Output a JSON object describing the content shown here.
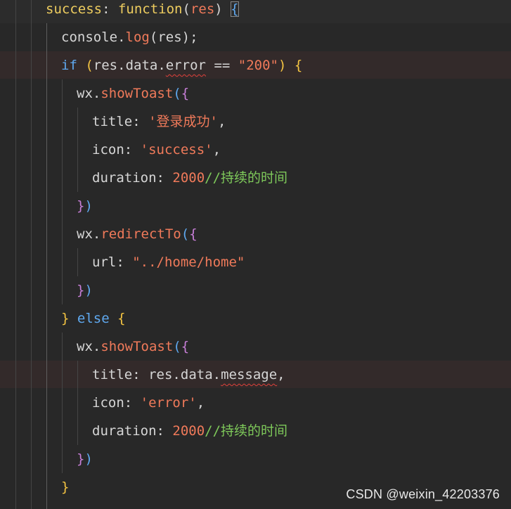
{
  "editor": {
    "theme": {
      "background": "#282828",
      "default_text": "#d6d6d6",
      "key": "#e8c4a0",
      "keyword": "#5fa9f0",
      "function": "#f07a5a",
      "string": "#f07a5a",
      "number": "#f07a5a",
      "comment": "#7ec95a",
      "paren_1": "#f5c542",
      "paren_2": "#5fa9f0",
      "paren_3": "#c87fd8",
      "squiggle": "#e0413b"
    },
    "lines": [
      {
        "indent": 65,
        "tokens": [
          {
            "t": "success",
            "c": "#eecd5f"
          },
          {
            "t": ": ",
            "c": "#d6d6d6"
          },
          {
            "t": "function",
            "c": "#eecd5f"
          },
          {
            "t": "(",
            "c": "#d6d6d6"
          },
          {
            "t": "res",
            "c": "#f07a5a"
          },
          {
            "t": ") ",
            "c": "#d6d6d6"
          },
          {
            "t": "{",
            "c": "#5fa9f0",
            "box": true
          }
        ]
      },
      {
        "indent": 87,
        "tokens": [
          {
            "t": "console",
            "c": "#d6d6d6"
          },
          {
            "t": ".",
            "c": "#d6d6d6"
          },
          {
            "t": "log",
            "c": "#f07a5a"
          },
          {
            "t": "(",
            "c": "#d6d6d6"
          },
          {
            "t": "res",
            "c": "#d6d6d6"
          },
          {
            "t": ");",
            "c": "#d6d6d6"
          }
        ]
      },
      {
        "indent": 87,
        "tokens": [
          {
            "t": "if",
            "c": "#5fa9f0"
          },
          {
            "t": " ",
            "c": "#d6d6d6"
          },
          {
            "t": "(",
            "c": "#f5c542"
          },
          {
            "t": "res",
            "c": "#d6d6d6"
          },
          {
            "t": ".",
            "c": "#d6d6d6"
          },
          {
            "t": "data",
            "c": "#d6d6d6"
          },
          {
            "t": ".",
            "c": "#d6d6d6"
          },
          {
            "t": "error",
            "c": "#d6d6d6",
            "squiggle": true
          },
          {
            "t": " == ",
            "c": "#d6d6d6"
          },
          {
            "t": "\"200\"",
            "c": "#f07a5a"
          },
          {
            "t": ") ",
            "c": "#f5c542"
          },
          {
            "t": "{",
            "c": "#f5c542"
          }
        ]
      },
      {
        "indent": 109,
        "tokens": [
          {
            "t": "wx",
            "c": "#d6d6d6"
          },
          {
            "t": ".",
            "c": "#d6d6d6"
          },
          {
            "t": "showToast",
            "c": "#f07a5a"
          },
          {
            "t": "(",
            "c": "#5fa9f0"
          },
          {
            "t": "{",
            "c": "#c87fd8"
          }
        ]
      },
      {
        "indent": 131,
        "tokens": [
          {
            "t": "title",
            "c": "#d6d6d6"
          },
          {
            "t": ": ",
            "c": "#d6d6d6"
          },
          {
            "t": "'登录成功'",
            "c": "#f07a5a"
          },
          {
            "t": ",",
            "c": "#d6d6d6"
          }
        ]
      },
      {
        "indent": 131,
        "tokens": [
          {
            "t": "icon",
            "c": "#d6d6d6"
          },
          {
            "t": ": ",
            "c": "#d6d6d6"
          },
          {
            "t": "'success'",
            "c": "#f07a5a"
          },
          {
            "t": ",",
            "c": "#d6d6d6"
          }
        ]
      },
      {
        "indent": 131,
        "tokens": [
          {
            "t": "duration",
            "c": "#d6d6d6"
          },
          {
            "t": ": ",
            "c": "#d6d6d6"
          },
          {
            "t": "2000",
            "c": "#f07a5a"
          },
          {
            "t": "//持续的时间",
            "c": "#7ec95a"
          }
        ]
      },
      {
        "indent": 109,
        "tokens": [
          {
            "t": "}",
            "c": "#c87fd8"
          },
          {
            "t": ")",
            "c": "#5fa9f0"
          }
        ]
      },
      {
        "indent": 109,
        "tokens": [
          {
            "t": "wx",
            "c": "#d6d6d6"
          },
          {
            "t": ".",
            "c": "#d6d6d6"
          },
          {
            "t": "redirectTo",
            "c": "#f07a5a"
          },
          {
            "t": "(",
            "c": "#5fa9f0"
          },
          {
            "t": "{",
            "c": "#c87fd8"
          }
        ]
      },
      {
        "indent": 131,
        "tokens": [
          {
            "t": "url",
            "c": "#d6d6d6"
          },
          {
            "t": ": ",
            "c": "#d6d6d6"
          },
          {
            "t": "\"../home/home\"",
            "c": "#f07a5a"
          }
        ]
      },
      {
        "indent": 109,
        "tokens": [
          {
            "t": "}",
            "c": "#c87fd8"
          },
          {
            "t": ")",
            "c": "#5fa9f0"
          }
        ]
      },
      {
        "indent": 87,
        "tokens": [
          {
            "t": "}",
            "c": "#f5c542"
          },
          {
            "t": " ",
            "c": "#d6d6d6"
          },
          {
            "t": "else",
            "c": "#5fa9f0"
          },
          {
            "t": " ",
            "c": "#d6d6d6"
          },
          {
            "t": "{",
            "c": "#f5c542"
          }
        ]
      },
      {
        "indent": 109,
        "tokens": [
          {
            "t": "wx",
            "c": "#d6d6d6"
          },
          {
            "t": ".",
            "c": "#d6d6d6"
          },
          {
            "t": "showToast",
            "c": "#f07a5a"
          },
          {
            "t": "(",
            "c": "#5fa9f0"
          },
          {
            "t": "{",
            "c": "#c87fd8"
          }
        ]
      },
      {
        "indent": 131,
        "tokens": [
          {
            "t": "title",
            "c": "#d6d6d6"
          },
          {
            "t": ": ",
            "c": "#d6d6d6"
          },
          {
            "t": "res",
            "c": "#d6d6d6"
          },
          {
            "t": ".",
            "c": "#d6d6d6"
          },
          {
            "t": "data",
            "c": "#d6d6d6"
          },
          {
            "t": ".",
            "c": "#d6d6d6"
          },
          {
            "t": "message",
            "c": "#d6d6d6",
            "squiggle": true
          },
          {
            "t": ",",
            "c": "#d6d6d6"
          }
        ]
      },
      {
        "indent": 131,
        "tokens": [
          {
            "t": "icon",
            "c": "#d6d6d6"
          },
          {
            "t": ": ",
            "c": "#d6d6d6"
          },
          {
            "t": "'error'",
            "c": "#f07a5a"
          },
          {
            "t": ",",
            "c": "#d6d6d6"
          }
        ]
      },
      {
        "indent": 131,
        "tokens": [
          {
            "t": "duration",
            "c": "#d6d6d6"
          },
          {
            "t": ": ",
            "c": "#d6d6d6"
          },
          {
            "t": "2000",
            "c": "#f07a5a"
          },
          {
            "t": "//持续的时间",
            "c": "#7ec95a"
          }
        ]
      },
      {
        "indent": 109,
        "tokens": [
          {
            "t": "}",
            "c": "#c87fd8"
          },
          {
            "t": ")",
            "c": "#5fa9f0"
          }
        ]
      },
      {
        "indent": 87,
        "tokens": [
          {
            "t": "}",
            "c": "#f5c542"
          }
        ]
      }
    ]
  },
  "watermark": "CSDN @weixin_42203376"
}
